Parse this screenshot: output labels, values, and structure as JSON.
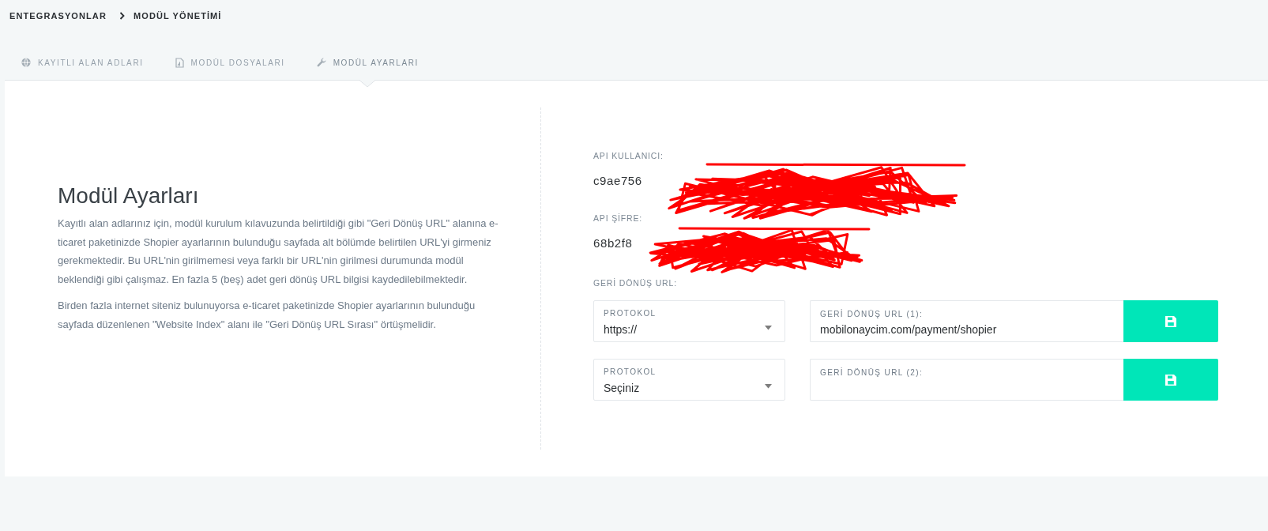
{
  "breadcrumb": [
    {
      "label": "ENTEGRASYONLAR"
    },
    {
      "label": "MODÜL YÖNETİMİ"
    }
  ],
  "tabs": [
    {
      "kind": "domains",
      "label": "KAYITLI ALAN ADLARI",
      "selected": false
    },
    {
      "kind": "files",
      "label": "MODÜL DOSYALARI",
      "selected": false
    },
    {
      "kind": "settings",
      "label": "MODÜL AYARLARI",
      "selected": true
    }
  ],
  "intro": {
    "title": "Modül Ayarları",
    "paragraphs": [
      "Kayıtlı alan adlarınız için, modül kurulum kılavuzunda belirtildiği gibi \"Geri Dönüş URL\" alanına e-ticaret paketinizde Shopier ayarlarının bulunduğu sayfada alt bölümde belirtilen URL'yi girmeniz gerekmektedir. Bu URL'nin girilmemesi veya farklı bir URL'nin girilmesi durumunda modül beklendiği gibi çalışmaz. En fazla 5 (beş) adet geri dönüş URL bilgisi kaydedilebilmektedir.",
      "Birden fazla internet siteniz bulunuyorsa e-ticaret paketinizde Shopier ayarlarının bulunduğu sayfada düzenlenen \"Website Index\" alanı ile \"Geri Dönüş URL Sırası\" örtüşmelidir."
    ]
  },
  "credentials": [
    {
      "label": "API KULLANICI:",
      "value": "c9ae756",
      "redacted": true
    },
    {
      "label": "API ŞİFRE:",
      "value": "68b2f8",
      "redacted": true
    }
  ],
  "callback": {
    "label": "GERİ DÖNÜŞ URL:",
    "rows": [
      {
        "protocol_label": "PROTOKOL",
        "protocol": "https://",
        "url_label": "GERİ DÖNÜŞ URL (1):",
        "url": "mobilonaycim.com/payment/shopier"
      },
      {
        "protocol_label": "PROTOKOL",
        "protocol": "Seçiniz",
        "url_label": "GERİ DÖNÜŞ URL (2):"
      }
    ]
  }
}
